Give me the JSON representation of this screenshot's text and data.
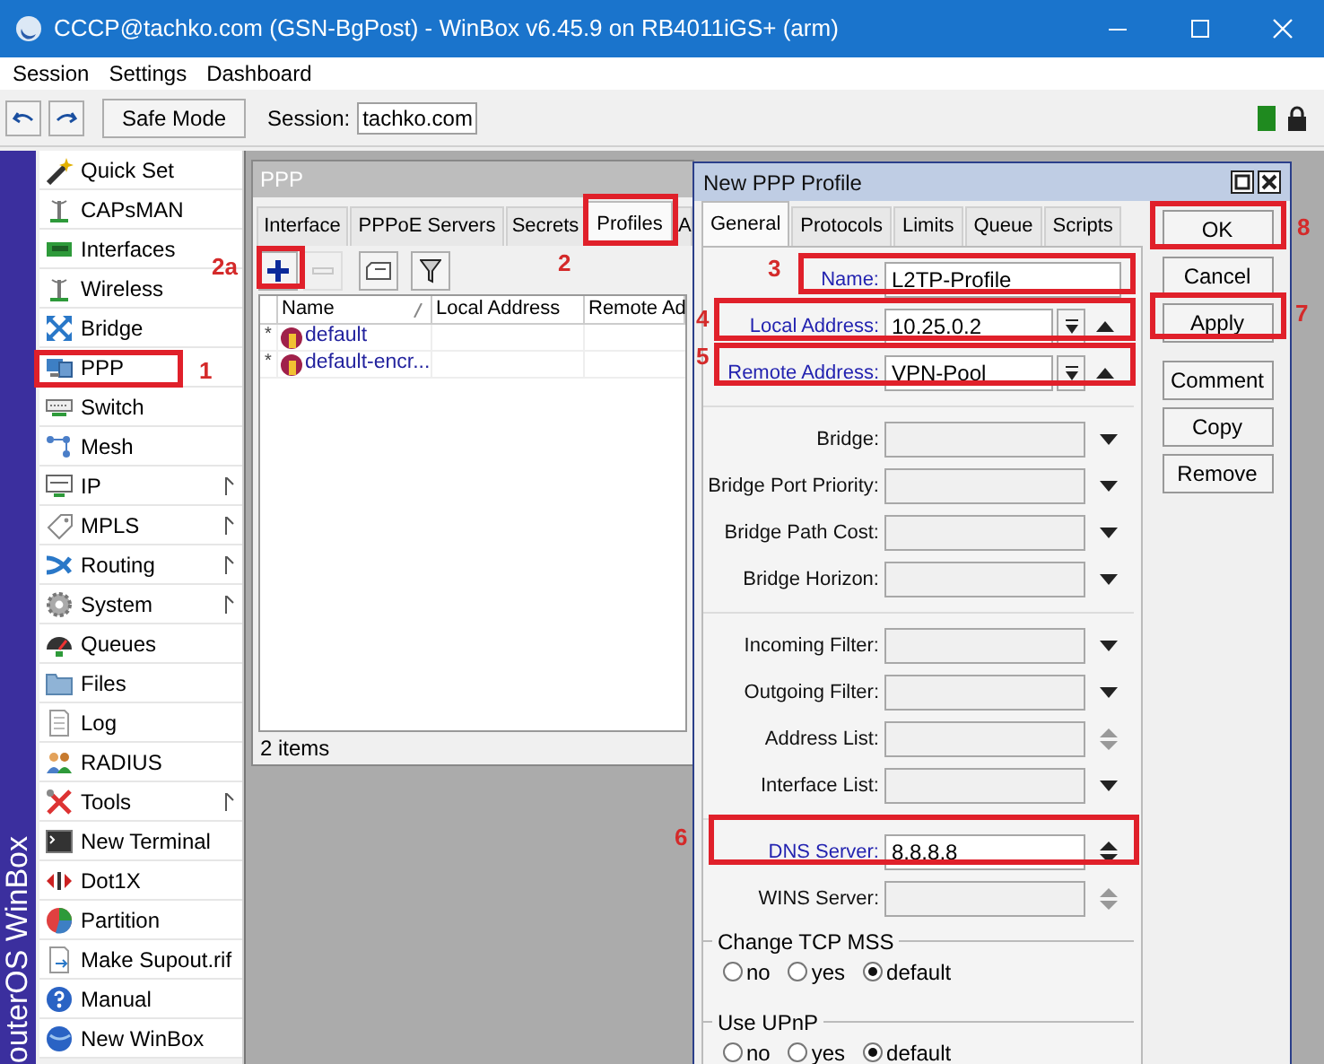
{
  "window": {
    "title": "CCCP@tachko.com (GSN-BgPost) - WinBox v6.45.9 on RB4011iGS+ (arm)"
  },
  "menu": [
    "Session",
    "Settings",
    "Dashboard"
  ],
  "toolbar": {
    "safe_mode": "Safe Mode",
    "session_label": "Session:",
    "session_value": "tachko.com"
  },
  "side_strip": "outerOS WinBox",
  "sidebar": {
    "items": [
      {
        "label": "Quick Set",
        "submenu": false
      },
      {
        "label": "CAPsMAN",
        "submenu": false
      },
      {
        "label": "Interfaces",
        "submenu": false
      },
      {
        "label": "Wireless",
        "submenu": false
      },
      {
        "label": "Bridge",
        "submenu": false
      },
      {
        "label": "PPP",
        "submenu": false
      },
      {
        "label": "Switch",
        "submenu": false
      },
      {
        "label": "Mesh",
        "submenu": false
      },
      {
        "label": "IP",
        "submenu": true
      },
      {
        "label": "MPLS",
        "submenu": true
      },
      {
        "label": "Routing",
        "submenu": true
      },
      {
        "label": "System",
        "submenu": true
      },
      {
        "label": "Queues",
        "submenu": false
      },
      {
        "label": "Files",
        "submenu": false
      },
      {
        "label": "Log",
        "submenu": false
      },
      {
        "label": "RADIUS",
        "submenu": false
      },
      {
        "label": "Tools",
        "submenu": true
      },
      {
        "label": "New Terminal",
        "submenu": false
      },
      {
        "label": "Dot1X",
        "submenu": false
      },
      {
        "label": "Partition",
        "submenu": false
      },
      {
        "label": "Make Supout.rif",
        "submenu": false
      },
      {
        "label": "Manual",
        "submenu": false
      },
      {
        "label": "New WinBox",
        "submenu": false
      }
    ]
  },
  "ppp_window": {
    "title": "PPP",
    "tabs": [
      {
        "label": "Interface",
        "selected": false
      },
      {
        "label": "PPPoE Servers",
        "selected": false
      },
      {
        "label": "Secrets",
        "selected": false
      },
      {
        "label": "Profiles",
        "selected": true
      },
      {
        "label": "A",
        "selected": false
      }
    ],
    "tools": [
      {
        "kind": "add",
        "disabled": false
      },
      {
        "kind": "remove",
        "disabled": true
      },
      {
        "kind": "comment",
        "disabled": false
      },
      {
        "kind": "filter",
        "disabled": false
      }
    ],
    "columns": [
      "Name",
      "Local Address",
      "Remote Ad"
    ],
    "rows": [
      {
        "flag": "*",
        "name": "default"
      },
      {
        "flag": "*",
        "name": "default-encr..."
      }
    ],
    "status": "2 items"
  },
  "dialog": {
    "title": "New PPP Profile",
    "tabs": [
      {
        "label": "General",
        "selected": true
      },
      {
        "label": "Protocols",
        "selected": false
      },
      {
        "label": "Limits",
        "selected": false
      },
      {
        "label": "Queue",
        "selected": false
      },
      {
        "label": "Scripts",
        "selected": false
      }
    ],
    "groups": [
      [
        {
          "label": "Name:",
          "kind": "text",
          "value": "L2TP-Profile",
          "emphasized": true
        },
        {
          "label": "Local Address:",
          "kind": "combo",
          "value": "10.25.0.2",
          "emphasized": true
        },
        {
          "label": "Remote Address:",
          "kind": "combo",
          "value": "VPN-Pool",
          "emphasized": true
        }
      ],
      [
        {
          "label": "Bridge:",
          "kind": "dropdown",
          "emphasized": false
        },
        {
          "label": "Bridge Port Priority:",
          "kind": "dropdown",
          "emphasized": false
        },
        {
          "label": "Bridge Path Cost:",
          "kind": "dropdown",
          "emphasized": false
        },
        {
          "label": "Bridge Horizon:",
          "kind": "dropdown",
          "emphasized": false
        }
      ],
      [
        {
          "label": "Incoming Filter:",
          "kind": "dropdown",
          "emphasized": false
        },
        {
          "label": "Outgoing Filter:",
          "kind": "dropdown",
          "emphasized": false
        },
        {
          "label": "Address List:",
          "kind": "spin",
          "emphasized": false
        },
        {
          "label": "Interface List:",
          "kind": "dropdown",
          "emphasized": false
        }
      ],
      [
        {
          "label": "DNS Server:",
          "kind": "spin",
          "value": "8.8.8.8",
          "emphasized": true
        },
        {
          "label": "WINS Server:",
          "kind": "spin",
          "emphasized": false
        }
      ]
    ],
    "radio_groups": [
      {
        "title": "Change TCP MSS",
        "options": [
          {
            "label": "no",
            "selected": false
          },
          {
            "label": "yes",
            "selected": false
          },
          {
            "label": "default",
            "selected": true
          }
        ]
      },
      {
        "title": "Use UPnP",
        "options": [
          {
            "label": "no",
            "selected": false
          },
          {
            "label": "yes",
            "selected": false
          },
          {
            "label": "default",
            "selected": true
          }
        ]
      }
    ],
    "buttons": [
      "OK",
      "Cancel",
      "Apply",
      "Comment",
      "Copy",
      "Remove"
    ]
  },
  "callouts": [
    {
      "label": "1"
    },
    {
      "label": "2a"
    },
    {
      "label": "2"
    },
    {
      "label": "3"
    },
    {
      "label": "4"
    },
    {
      "label": "5"
    },
    {
      "label": "6"
    },
    {
      "label": "7"
    },
    {
      "label": "8"
    }
  ]
}
